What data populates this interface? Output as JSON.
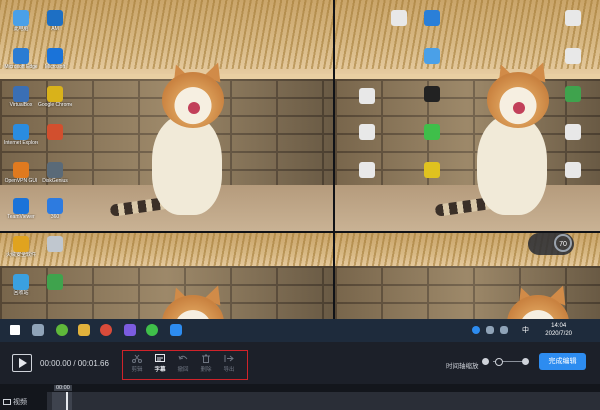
{
  "preview": {
    "speed_indicator": "70",
    "taskbar": {
      "time": "14:04",
      "date": "2020/7/20",
      "ime": "中"
    },
    "desktop_icons_left": [
      {
        "label": "此电脑",
        "color": "#4aa0e8"
      },
      {
        "label": "Microsoft Edge",
        "color": "#2b7cd3"
      },
      {
        "label": "VirtualBox",
        "color": "#3a6fb5"
      },
      {
        "label": "Internet Explorer",
        "color": "#2a8ce0"
      },
      {
        "label": "OpenVPN GUI",
        "color": "#e07a1f"
      },
      {
        "label": "TeamViewer",
        "color": "#1a73d9"
      },
      {
        "label": "火绒安全软件",
        "color": "#e0a31f"
      },
      {
        "label": "回收站",
        "color": "#3aa0e0"
      }
    ],
    "desktop_icons_left2": [
      {
        "label": "AM",
        "color": "#1d6fc4"
      },
      {
        "label": "Microsoft",
        "color": "#1a73d9"
      },
      {
        "label": "Google Chrome",
        "color": "#d9b21a"
      },
      {
        "label": "",
        "color": "#d24f2e"
      },
      {
        "label": "DiskGenius",
        "color": "#5a6a78"
      },
      {
        "label": "360",
        "color": "#2d7be0"
      },
      {
        "label": "",
        "color": "#c0c7cf"
      },
      {
        "label": "",
        "color": "#3fa34d"
      }
    ],
    "desktop_icons_right": [
      {
        "label": "",
        "color": "#e8e8e8"
      },
      {
        "label": "",
        "color": "#e8e8e8"
      },
      {
        "label": "",
        "color": "#e8e8e8"
      },
      {
        "label": "",
        "color": "#e8e8e8"
      }
    ]
  },
  "controls": {
    "timecode": "00:00.00 / 00:01.66",
    "tools": [
      {
        "label": "剪辑",
        "active": false
      },
      {
        "label": "字幕",
        "active": true
      },
      {
        "label": "撤回",
        "active": false
      },
      {
        "label": "删除",
        "active": false
      },
      {
        "label": "导出",
        "active": false
      }
    ],
    "zoom_label": "时间轴缩放",
    "zoom_level": 0.1,
    "finish_label": "完成编辑"
  },
  "timeline": {
    "track_label": "视频",
    "playhead_time": "00:00"
  },
  "colors": {
    "accent": "#2d8cf0",
    "highlight_border": "#d0232a",
    "panel_bg": "#1c2029",
    "taskbar_bg": "#1e2b3c"
  }
}
